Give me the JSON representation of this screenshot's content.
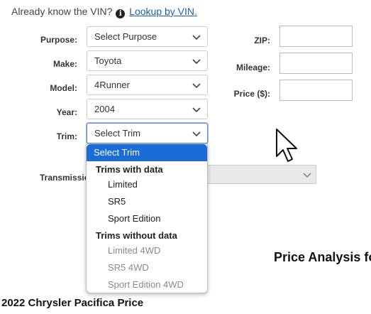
{
  "vin": {
    "prefix": "Already know the VIN?",
    "link": "Lookup by VIN."
  },
  "form": {
    "purpose": {
      "label": "Purpose:",
      "value": "Select Purpose"
    },
    "make": {
      "label": "Make:",
      "value": "Toyota"
    },
    "model": {
      "label": "Model:",
      "value": "4Runner"
    },
    "year": {
      "label": "Year:",
      "value": "2004"
    },
    "trim": {
      "label": "Trim:",
      "value": "Select Trim"
    },
    "transmission": {
      "label": "Transmissio"
    },
    "zip": {
      "label": "ZIP:",
      "value": ""
    },
    "mileage": {
      "label": "Mileage:",
      "value": ""
    },
    "price": {
      "label": "Price ($):",
      "value": ""
    }
  },
  "trim_dropdown": {
    "selected": "Select Trim",
    "group_with_data": "Trims with data",
    "with_data": [
      "Limited",
      "SR5",
      "Sport Edition"
    ],
    "group_without_data": "Trims without data",
    "without_data": [
      "Limited 4WD",
      "SR5 4WD",
      "Sport Edition 4WD"
    ]
  },
  "headings": {
    "price_analysis": "Price Analysis fo",
    "bottom": "2022 Chrysler Pacifica Price"
  },
  "colors": {
    "link": "#1a5fb4",
    "selected_option_bg": "#1c6cd8",
    "disabled_option": "#8a8a8a"
  },
  "icons": [
    "info-circle-icon",
    "chevron-down-icon",
    "mouse-pointer-icon"
  ]
}
